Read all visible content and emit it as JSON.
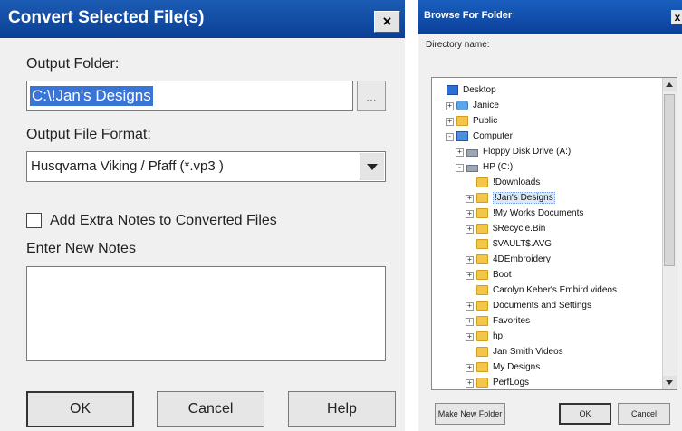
{
  "convert_dialog": {
    "title": "Convert Selected File(s)",
    "close_glyph": "×",
    "output_folder_label": "Output Folder:",
    "output_folder_value": "C:\\!Jan's Designs",
    "browse_button": "...",
    "output_format_label": "Output File Format:",
    "output_format_value": "Husqvarna Viking / Pfaff (*.vp3 )",
    "extra_notes_checkbox_label": "Add Extra Notes to Converted Files",
    "extra_notes_checked": false,
    "enter_notes_label": "Enter New Notes",
    "notes_value": "",
    "ok_button": "OK",
    "cancel_button": "Cancel",
    "help_button": "Help"
  },
  "browse_dialog": {
    "title": "Browse For Folder",
    "close_glyph": "x",
    "directory_name_label": "Directory name:",
    "tree": [
      {
        "label": "Desktop",
        "icon": "desktop-icon",
        "expander": ""
      },
      {
        "label": "Janice",
        "icon": "user-folder-icon",
        "expander": "+"
      },
      {
        "label": "Public",
        "icon": "folder-icon",
        "expander": "+"
      },
      {
        "label": "Computer",
        "icon": "computer-icon",
        "expander": "-"
      },
      {
        "label": "Floppy Disk Drive (A:)",
        "icon": "floppy-drive-icon",
        "expander": "+"
      },
      {
        "label": "HP (C:)",
        "icon": "hard-drive-icon",
        "expander": "-"
      },
      {
        "label": "!Downloads",
        "icon": "folder-icon",
        "expander": ""
      },
      {
        "label": "!Jan's Designs",
        "icon": "folder-icon",
        "expander": "+",
        "selected": true
      },
      {
        "label": "!My Works Documents",
        "icon": "folder-icon",
        "expander": "+"
      },
      {
        "label": "$Recycle.Bin",
        "icon": "folder-icon",
        "expander": "+"
      },
      {
        "label": "$VAULT$.AVG",
        "icon": "folder-icon",
        "expander": ""
      },
      {
        "label": "4DEmbroidery",
        "icon": "folder-icon",
        "expander": "+"
      },
      {
        "label": "Boot",
        "icon": "folder-icon",
        "expander": "+"
      },
      {
        "label": "Carolyn Keber's Embird videos",
        "icon": "folder-icon",
        "expander": ""
      },
      {
        "label": "Documents and Settings",
        "icon": "shortcut-folder-icon",
        "expander": "+"
      },
      {
        "label": "Favorites",
        "icon": "folder-icon",
        "expander": "+"
      },
      {
        "label": "hp",
        "icon": "folder-icon",
        "expander": "+"
      },
      {
        "label": "Jan Smith Videos",
        "icon": "folder-icon",
        "expander": ""
      },
      {
        "label": "My Designs",
        "icon": "folder-icon",
        "expander": "+"
      },
      {
        "label": "PerfLogs",
        "icon": "folder-icon",
        "expander": "+"
      }
    ],
    "make_new_folder_button": "Make New Folder",
    "ok_button": "OK",
    "cancel_button": "Cancel"
  }
}
